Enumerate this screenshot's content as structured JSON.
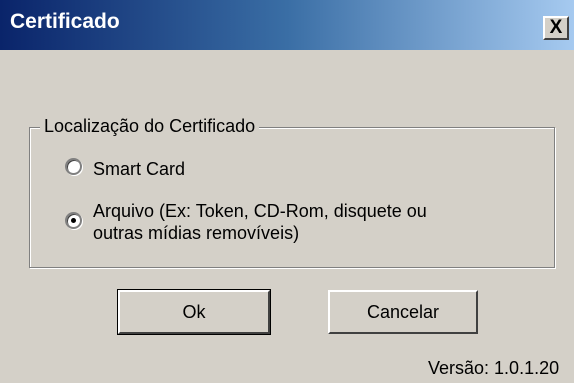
{
  "window": {
    "title": "Certificado",
    "close_label": "X"
  },
  "group": {
    "legend": "Localização do Certificado",
    "options": [
      {
        "label": "Smart Card",
        "selected": false
      },
      {
        "label_line1": "Arquivo (Ex: Token, CD-Rom, disquete ou",
        "label_line2": "outras mídias removíveis)",
        "selected": true
      }
    ]
  },
  "buttons": {
    "ok_label": "Ok",
    "cancel_label": "Cancelar"
  },
  "footer": {
    "version": "Versão: 1.0.1.20"
  }
}
